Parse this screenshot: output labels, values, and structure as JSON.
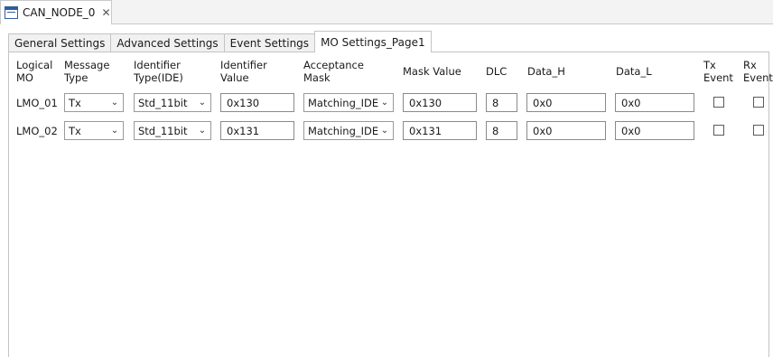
{
  "editor": {
    "tab_title": "CAN_NODE_0",
    "tab_icon": "config-editor-icon",
    "close_symbol": "✕"
  },
  "settings_tabs": [
    "General Settings",
    "Advanced Settings",
    "Event Settings",
    "MO Settings_Page1"
  ],
  "active_tab": "MO Settings_Page1",
  "columns": {
    "logical_mo": [
      "Logical",
      "MO"
    ],
    "message_type": [
      "Message",
      "Type"
    ],
    "identifier_type": [
      "Identifier",
      "Type(IDE)"
    ],
    "identifier_value": [
      "Identifier",
      "Value"
    ],
    "acceptance_mask": [
      "Acceptance",
      "Mask"
    ],
    "mask_value": "Mask Value",
    "dlc": "DLC",
    "data_h": "Data_H",
    "data_l": "Data_L",
    "tx_event": [
      "Tx",
      "Event"
    ],
    "rx_event": [
      "Rx",
      "Event"
    ]
  },
  "rows": [
    {
      "logical_mo": "LMO_01",
      "message_type": "Tx",
      "identifier_type": "Std_11bit",
      "identifier_value": "0x130",
      "acceptance_mask": "Matching_IDE",
      "mask_value": "0x130",
      "dlc": "8",
      "data_h": "0x0",
      "data_l": "0x0",
      "tx_event": false,
      "rx_event": false
    },
    {
      "logical_mo": "LMO_02",
      "message_type": "Tx",
      "identifier_type": "Std_11bit",
      "identifier_value": "0x131",
      "acceptance_mask": "Matching_IDE",
      "mask_value": "0x131",
      "dlc": "8",
      "data_h": "0x0",
      "data_l": "0x0",
      "tx_event": false,
      "rx_event": false
    }
  ],
  "dropdown_symbol": "⌄"
}
